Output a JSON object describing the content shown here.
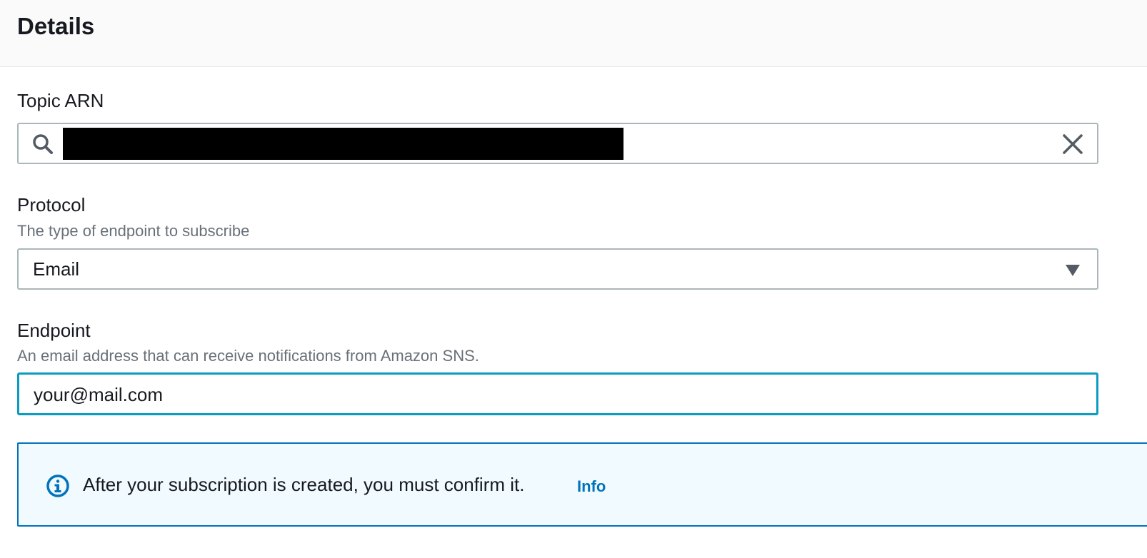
{
  "section": {
    "title": "Details"
  },
  "topic_arn": {
    "label": "Topic ARN",
    "value": "",
    "redacted": true,
    "icons": {
      "search": "search-icon",
      "clear": "close-icon"
    }
  },
  "protocol": {
    "label": "Protocol",
    "description": "The type of endpoint to subscribe",
    "selected": "Email",
    "icon": "caret-down-icon"
  },
  "endpoint": {
    "label": "Endpoint",
    "description": "An email address that can receive notifications from Amazon SNS.",
    "value": "your@mail.com"
  },
  "alert": {
    "message": "After your subscription is created, you must confirm it.",
    "link": "Info",
    "icon": "info-icon"
  },
  "colors": {
    "accent": "#0073bb",
    "focus": "#0a9dc0",
    "alert_bg": "#f1faff"
  }
}
